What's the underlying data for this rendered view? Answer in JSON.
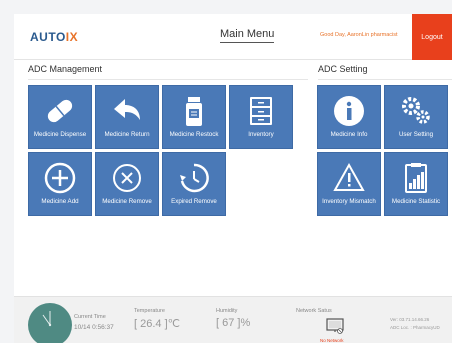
{
  "header": {
    "logo_main": "AUTO",
    "logo_accent": "IX",
    "menu_title": "Main Menu",
    "greeting": "Good Day, AaronLin pharmacist",
    "logout_label": "Logout"
  },
  "colors": {
    "tile": "#4a79b7",
    "logout": "#e8401c",
    "accent": "#e8732a",
    "clock": "#4f8a83"
  },
  "adc_management": {
    "title": "ADC Management",
    "tiles": [
      {
        "label": "Medicine Dispense",
        "icon": "pill-icon"
      },
      {
        "label": "Medicine Return",
        "icon": "reply-arrow-icon"
      },
      {
        "label": "Medicine Restock",
        "icon": "medicine-bottle-icon"
      },
      {
        "label": "Inventory",
        "icon": "drawer-cabinet-icon"
      },
      {
        "label": "Medicine Add",
        "icon": "plus-circle-icon"
      },
      {
        "label": "Medicine Remove",
        "icon": "x-circle-icon"
      },
      {
        "label": "Expired Remove",
        "icon": "clock-refresh-icon"
      }
    ]
  },
  "adc_setting": {
    "title": "ADC Setting",
    "tiles": [
      {
        "label": "Medicine Info",
        "icon": "info-icon"
      },
      {
        "label": "User Setting",
        "icon": "gears-icon"
      },
      {
        "label": "Inventory Mismatch",
        "icon": "warning-icon"
      },
      {
        "label": "Medicine Statistic",
        "icon": "clipboard-chart-icon"
      }
    ]
  },
  "footer": {
    "current_time_label": "Current Time",
    "current_time_value": "10/14 0:56:37",
    "temperature_label": "Temperature",
    "temperature_value": "[ 26.4 ]℃",
    "humidity_label": "Humidity",
    "humidity_value": "[ 67 ]%",
    "network_label": "Network Satus",
    "network_status": "No Network",
    "version": "Ver: 03.71.14.66.26",
    "adc_location": "ADC Loc. : PharmacyUD"
  }
}
